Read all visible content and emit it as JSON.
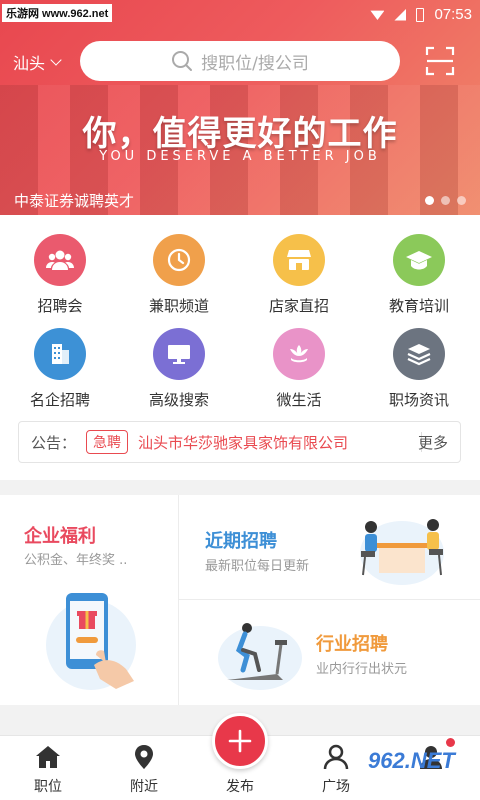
{
  "watermark": "乐游网 www.962.net",
  "status": {
    "time": "07:53"
  },
  "header": {
    "city": "汕头",
    "search_placeholder": "搜职位/搜公司",
    "slogan": "你，值得更好的工作",
    "slogan_en": "YOU DESERVE A BETTER JOB",
    "banner_caption": "中泰证券诚聘英才"
  },
  "menu": [
    {
      "label": "招聘会",
      "color": "#ea5a6e",
      "icon": "people-icon"
    },
    {
      "label": "兼职频道",
      "color": "#f0a04b",
      "icon": "clock-icon"
    },
    {
      "label": "店家直招",
      "color": "#f6c04a",
      "icon": "shop-icon"
    },
    {
      "label": "教育培训",
      "color": "#8bc95a",
      "icon": "graduation-cap-icon"
    },
    {
      "label": "名企招聘",
      "color": "#3d91d6",
      "icon": "building-icon"
    },
    {
      "label": "高级搜索",
      "color": "#7b6fd4",
      "icon": "monitor-icon"
    },
    {
      "label": "微生活",
      "color": "#e993c8",
      "icon": "flower-icon"
    },
    {
      "label": "职场资讯",
      "color": "#6c7480",
      "icon": "layers-icon"
    }
  ],
  "notice": {
    "label": "公告：",
    "tag": "急聘",
    "text": "汕头市华莎驰家具家饰有限公司",
    "more": "更多"
  },
  "cards": {
    "welfare": {
      "title": "企业福利",
      "sub": "公积金、年终奖 ..",
      "color": "#e94a5f"
    },
    "recent": {
      "title": "近期招聘",
      "sub": "最新职位每日更新",
      "color": "#3d8fd6"
    },
    "industry": {
      "title": "行业招聘",
      "sub": "业内行行出状元",
      "color": "#f09a3c"
    }
  },
  "tabbar": {
    "position": "职位",
    "nearby": "附近",
    "publish": "发布",
    "square": "广场"
  },
  "site_logo": "962.NET"
}
